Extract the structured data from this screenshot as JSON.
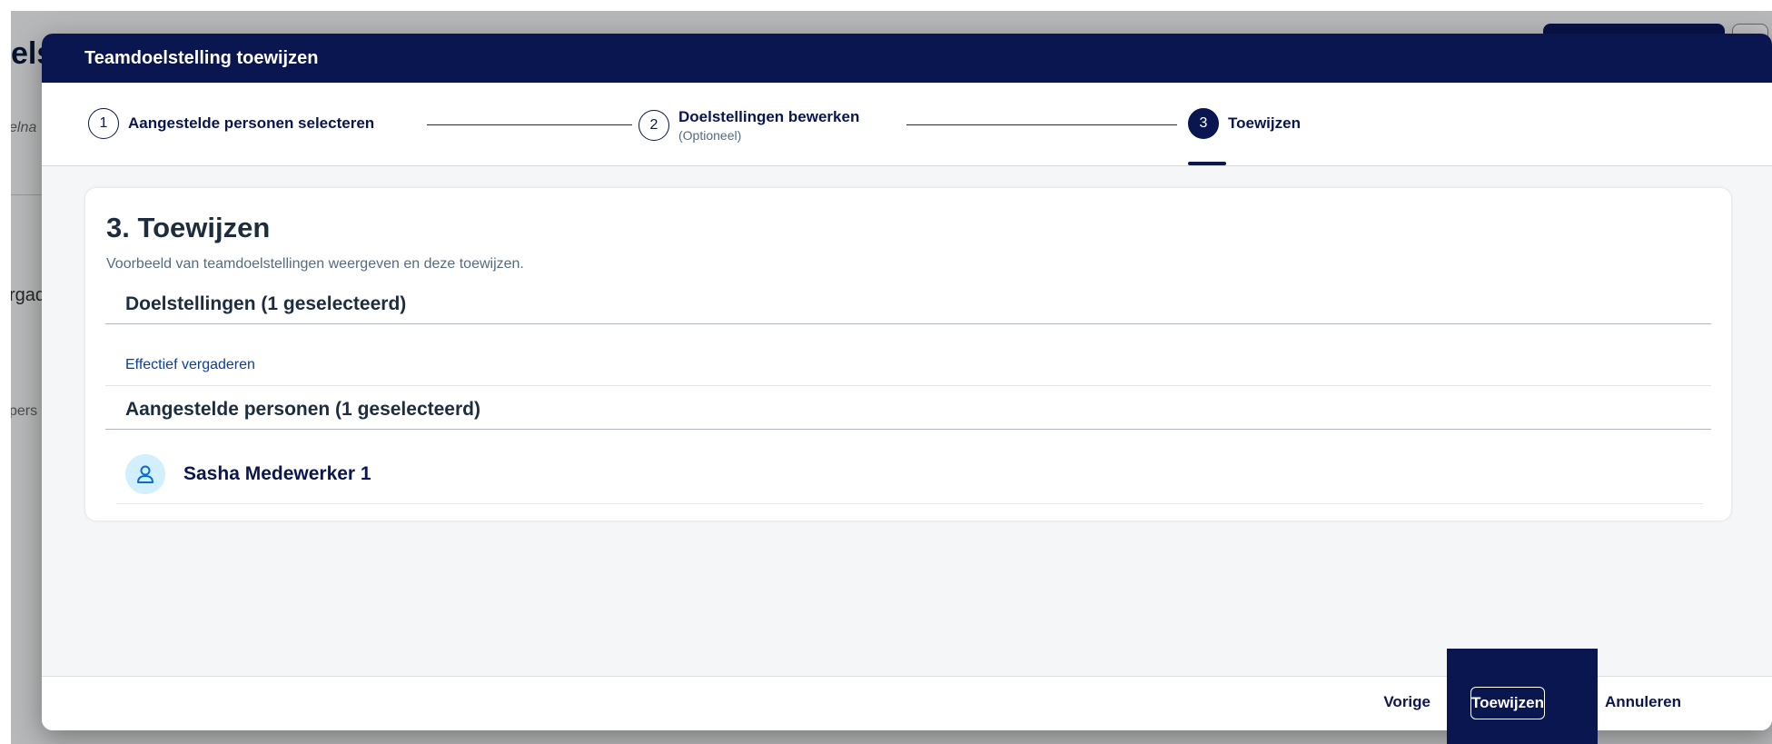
{
  "background": {
    "title_fragment": "els",
    "side_fragments": [
      "elna",
      "rgad",
      "pers"
    ]
  },
  "dialog": {
    "title": "Teamdoelstelling toewijzen",
    "steps": [
      {
        "number": "1",
        "label": "Aangestelde personen selecteren",
        "sub": ""
      },
      {
        "number": "2",
        "label": "Doelstellingen bewerken",
        "sub": "(Optioneel)"
      },
      {
        "number": "3",
        "label": "Toewijzen",
        "sub": ""
      }
    ],
    "active_step": 3,
    "content": {
      "title": "3. Toewijzen",
      "description": "Voorbeeld van teamdoelstellingen weergeven en deze toewijzen.",
      "goals_header": "Doelstellingen (1 geselecteerd)",
      "goals": [
        "Effectief vergaderen"
      ],
      "persons_header": "Aangestelde personen (1 geselecteerd)",
      "persons": [
        "Sasha Medewerker 1"
      ]
    },
    "footer": {
      "previous_label": "Vorige",
      "primary_label": "Toewijzen",
      "cancel_label": "Annuleren"
    }
  },
  "colors": {
    "brand": "#0a1650",
    "link": "#0a3e9e",
    "avatar_bg": "#d1efff"
  }
}
